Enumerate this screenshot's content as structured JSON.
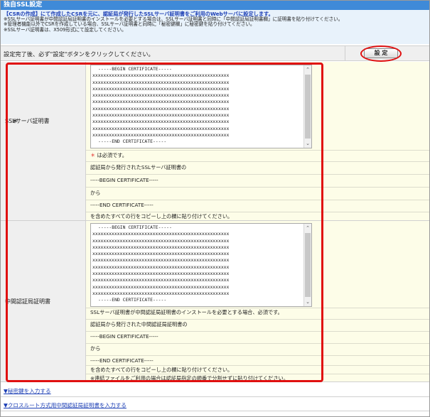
{
  "title": "独自SSL設定",
  "intro": {
    "lead": "【CSRの作成】にて作成したCSRを元に、認証局が発行したSSLサーバ証明書をご利用のWebサーバに設定します。",
    "notes": [
      "※SSLサーバ証明書が中間認証局証明書のインストールを必要とする場合は、SSLサーバ証明書と同時に「中間認証局証明書欄」に証明書を貼り付けてください。",
      "※管理者機能以外でCSRを作成している場合、SSLサーバ証明書と同時に「秘密鍵欄」に秘密鍵を貼り付けてください。",
      "※SSLサーバ証明書は、X509形式にて設定してください。"
    ]
  },
  "action_bar": {
    "message": "設定完了後、必ず\"設定\"ボタンをクリックしてください。",
    "set_label": "設 定"
  },
  "ssl_cert": {
    "label": "SSLサーバ証明書",
    "required_mark": "＊",
    "textarea_lines": [
      "-----BEGIN CERTIFICATE-----",
      "xxxxxxxxxxxxxxxxxxxxxxxxxxxxxxxxxxxxxxxxxxxxxxxxxx",
      "xxxxxxxxxxxxxxxxxxxxxxxxxxxxxxxxxxxxxxxxxxxxxxxxxx",
      "xxxxxxxxxxxxxxxxxxxxxxxxxxxxxxxxxxxxxxxxxxxxxxxxxx",
      "xxxxxxxxxxxxxxxxxxxxxxxxxxxxxxxxxxxxxxxxxxxxxxxxxx",
      "xxxxxxxxxxxxxxxxxxxxxxxxxxxxxxxxxxxxxxxxxxxxxxxxxx",
      "xxxxxxxxxxxxxxxxxxxxxxxxxxxxxxxxxxxxxxxxxxxxxxxxxx",
      "xxxxxxxxxxxxxxxxxxxxxxxxxxxxxxxxxxxxxxxxxxxxxxxxxx",
      "xxxxxxxxxxxxxxxxxxxxxxxxxxxxxxxxxxxxxxxxxxxxxxxxxx",
      "xxxxxxxxxxxxxxxxxxxxxxxxxxxxxxxxxxxxxxxxxxxxxxxxxx",
      "xxxxxxxxxxxxxxxxxxxxxxxxxxxxxxxxxxxxxxxxxxxxxxxxxx",
      "-----END CERTIFICATE-----"
    ],
    "help": [
      "＊ は必須です。",
      "認証局から発行されたSSLサーバ証明書の",
      "-----BEGIN CERTIFICATE-----",
      "から",
      "-----END CERTIFICATE-----",
      "を含めたすべての行をコピーし上の欄に貼り付けてください。"
    ]
  },
  "intermediate_cert": {
    "label": "中間認証局証明書",
    "textarea_lines": [
      "-----BEGIN CERTIFICATE-----",
      "xxxxxxxxxxxxxxxxxxxxxxxxxxxxxxxxxxxxxxxxxxxxxxxxxx",
      "xxxxxxxxxxxxxxxxxxxxxxxxxxxxxxxxxxxxxxxxxxxxxxxxxx",
      "xxxxxxxxxxxxxxxxxxxxxxxxxxxxxxxxxxxxxxxxxxxxxxxxxx",
      "xxxxxxxxxxxxxxxxxxxxxxxxxxxxxxxxxxxxxxxxxxxxxxxxxx",
      "xxxxxxxxxxxxxxxxxxxxxxxxxxxxxxxxxxxxxxxxxxxxxxxxxx",
      "xxxxxxxxxxxxxxxxxxxxxxxxxxxxxxxxxxxxxxxxxxxxxxxxxx",
      "xxxxxxxxxxxxxxxxxxxxxxxxxxxxxxxxxxxxxxxxxxxxxxxxxx",
      "xxxxxxxxxxxxxxxxxxxxxxxxxxxxxxxxxxxxxxxxxxxxxxxxxx",
      "xxxxxxxxxxxxxxxxxxxxxxxxxxxxxxxxxxxxxxxxxxxxxxxxxx",
      "xxxxxxxxxxxxxxxxxxxxxxxxxxxxxxxxxxxxxxxxxxxxxxxxxx",
      "-----END CERTIFICATE-----"
    ],
    "help": [
      "SSLサーバ証明書が中間認証局証明書のインストールを必要とする場合、必須です。",
      "認証局から発行された中間認証局証明書の",
      "-----BEGIN CERTIFICATE-----",
      "から",
      "-----END CERTIFICATE-----",
      "を含めたすべての行をコピーし上の欄に貼り付けてください。",
      "※連結ファイルをご利用の場合は認証局指定の順番で分割せずに貼り付けてください。"
    ]
  },
  "links": {
    "private_key": "▼秘密鍵を入力する",
    "cross_root": "▼クロスルート方式用中間認証局証明書を入力する"
  },
  "colors": {
    "title_bar": "#3f8ad8",
    "intro_bg": "#e8f2fb",
    "content_bg": "#fdfde8",
    "highlight": "#e01010",
    "link": "#1c3fb5"
  }
}
